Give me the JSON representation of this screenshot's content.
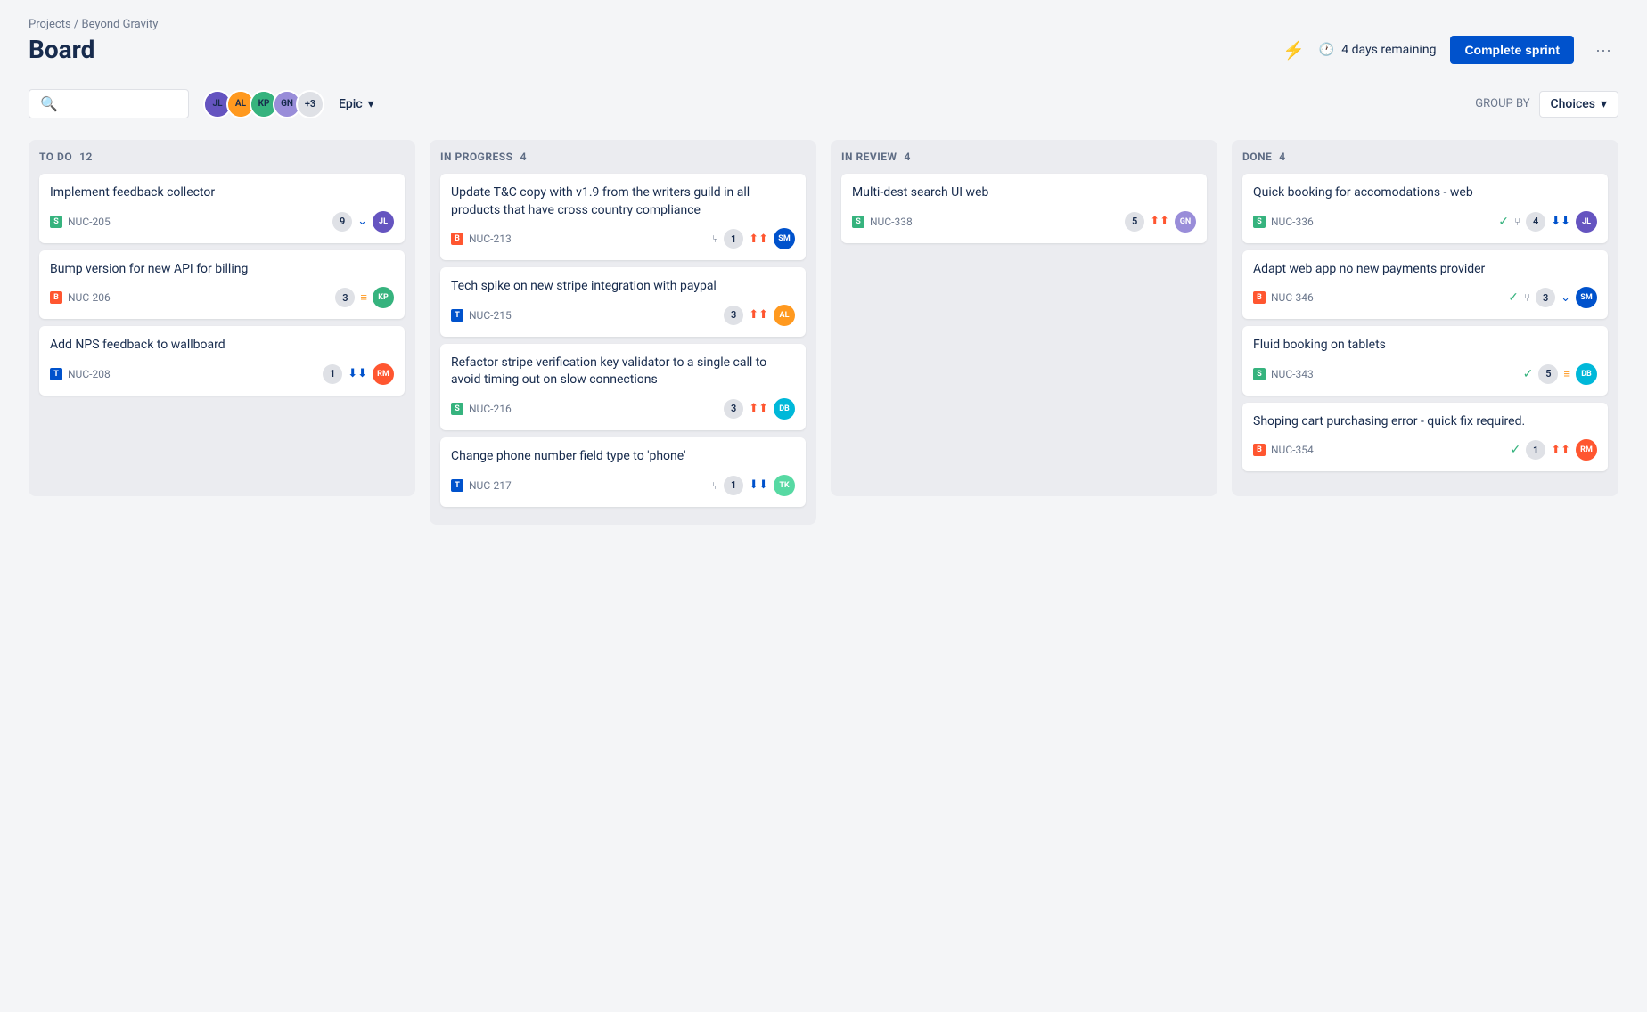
{
  "breadcrumb": "Projects / Beyond Gravity",
  "page_title": "Board",
  "header": {
    "sprint_remaining": "4 days remaining",
    "complete_sprint_label": "Complete sprint",
    "more_label": "···"
  },
  "toolbar": {
    "search_placeholder": "",
    "epic_label": "Epic",
    "group_by_label": "GROUP BY",
    "choices_label": "Choices",
    "avatars_extra": "+3"
  },
  "columns": [
    {
      "id": "todo",
      "title": "TO DO",
      "count": 12,
      "cards": [
        {
          "title": "Implement feedback collector",
          "issue_id": "NUC-205",
          "issue_type": "story",
          "badge": "9",
          "priority": "down",
          "avatar_initials": "JL",
          "avatar_color": "av-1"
        },
        {
          "title": "Bump version for new API for billing",
          "issue_id": "NUC-206",
          "issue_type": "bug",
          "badge": "3",
          "priority": "medium",
          "avatar_initials": "KP",
          "avatar_color": "av-2"
        },
        {
          "title": "Add NPS feedback to wallboard",
          "issue_id": "NUC-208",
          "issue_type": "task",
          "badge": "1",
          "priority": "down_double",
          "avatar_initials": "RM",
          "avatar_color": "av-3"
        }
      ]
    },
    {
      "id": "inprogress",
      "title": "IN PROGRESS",
      "count": 4,
      "cards": [
        {
          "title": "Update T&C copy with v1.9 from the writers guild in all products that have cross country compliance",
          "issue_id": "NUC-213",
          "issue_type": "bug",
          "badge": "1",
          "priority": "high",
          "branch_count": "1",
          "avatar_initials": "SM",
          "avatar_color": "av-4"
        },
        {
          "title": "Tech spike on new stripe integration with paypal",
          "issue_id": "NUC-215",
          "issue_type": "task",
          "badge": "3",
          "priority": "high",
          "avatar_initials": "AL",
          "avatar_color": "av-5"
        },
        {
          "title": "Refactor stripe verification key validator to a single call to avoid timing out on slow connections",
          "issue_id": "NUC-216",
          "issue_type": "story",
          "badge": "3",
          "priority": "high",
          "avatar_initials": "DB",
          "avatar_color": "av-6"
        },
        {
          "title": "Change phone number field type to 'phone'",
          "issue_id": "NUC-217",
          "issue_type": "task",
          "badge": "1",
          "priority": "down_double",
          "branch_count": "1",
          "avatar_initials": "TK",
          "avatar_color": "av-7"
        }
      ]
    },
    {
      "id": "inreview",
      "title": "IN REVIEW",
      "count": 4,
      "cards": [
        {
          "title": "Multi-dest search UI web",
          "issue_id": "NUC-338",
          "issue_type": "story",
          "badge": "5",
          "priority": "high",
          "avatar_initials": "GN",
          "avatar_color": "av-8"
        }
      ]
    },
    {
      "id": "done",
      "title": "DONE",
      "count": 4,
      "cards": [
        {
          "title": "Quick booking for accomodations - web",
          "issue_id": "NUC-336",
          "issue_type": "story",
          "badge": "4",
          "priority": "down_double",
          "show_check": true,
          "show_branch": true,
          "avatar_initials": "JL",
          "avatar_color": "av-1"
        },
        {
          "title": "Adapt web app no new payments provider",
          "issue_id": "NUC-346",
          "issue_type": "bug",
          "badge": "3",
          "priority": "down",
          "show_check": true,
          "show_branch": true,
          "avatar_initials": "SM",
          "avatar_color": "av-4"
        },
        {
          "title": "Fluid booking on tablets",
          "issue_id": "NUC-343",
          "issue_type": "story",
          "badge": "5",
          "priority": "medium",
          "show_check": true,
          "avatar_initials": "DB",
          "avatar_color": "av-6"
        },
        {
          "title": "Shoping cart purchasing error - quick fix required.",
          "issue_id": "NUC-354",
          "issue_type": "bug",
          "badge": "1",
          "priority": "high",
          "show_check": true,
          "avatar_initials": "RM",
          "avatar_color": "av-3"
        }
      ]
    }
  ]
}
